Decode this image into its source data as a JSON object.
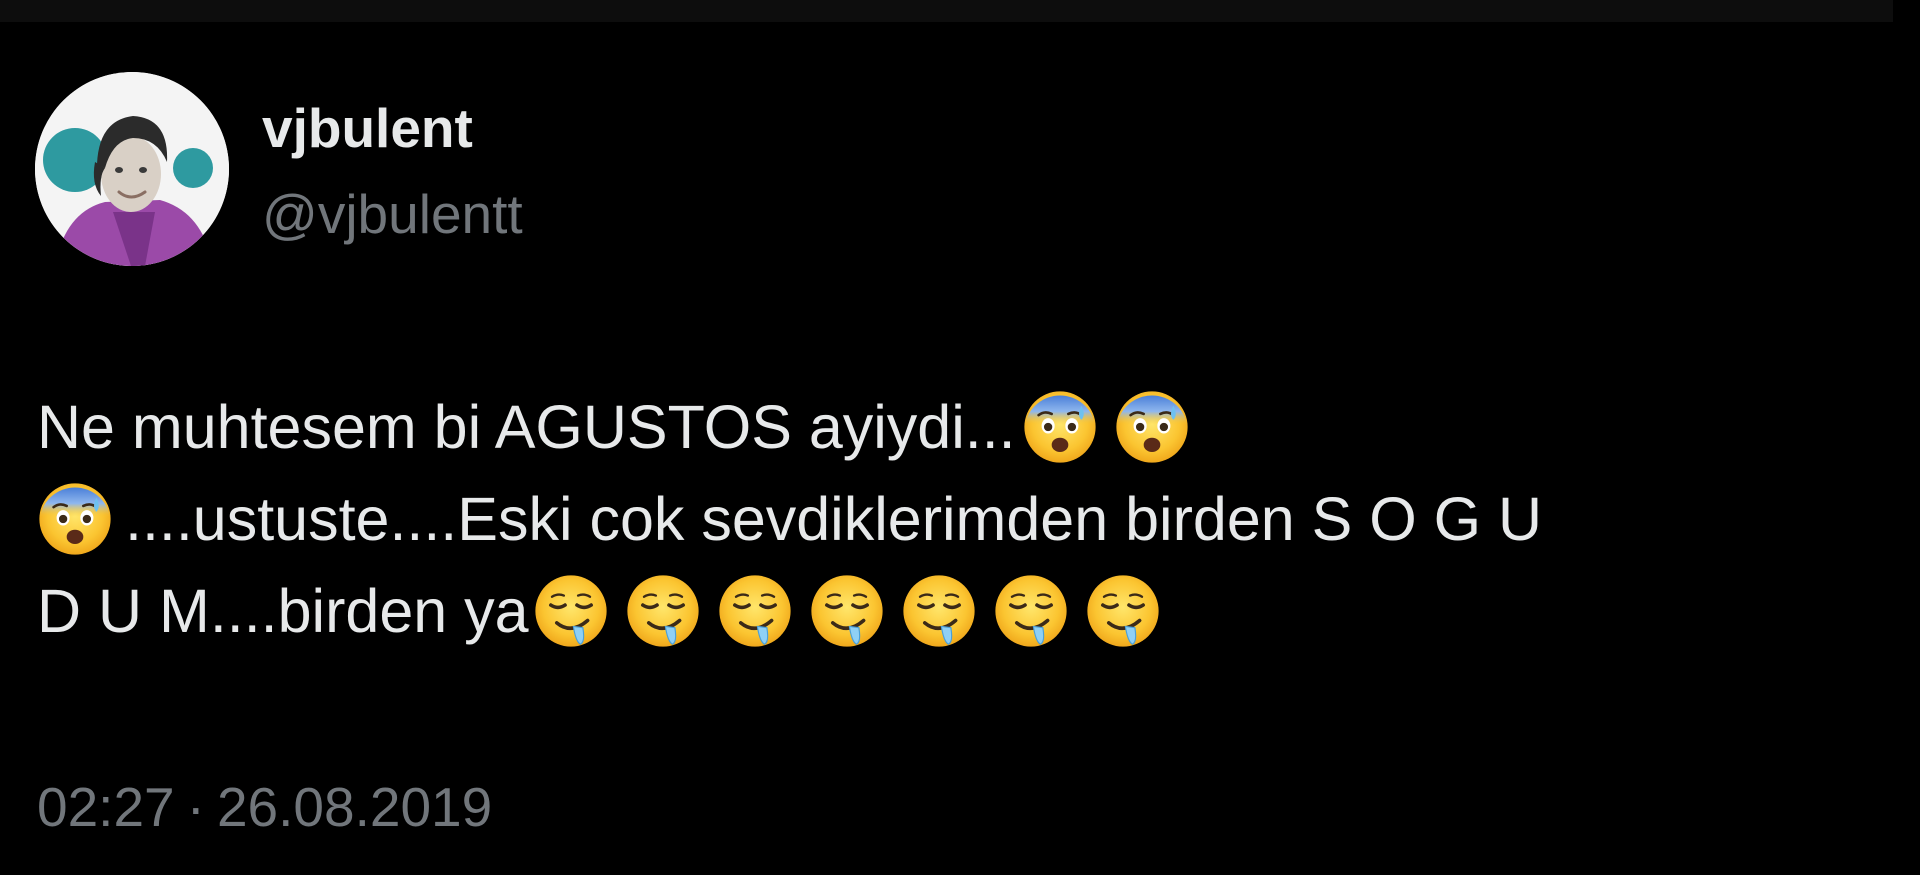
{
  "author": {
    "display_name": "vjbulent",
    "handle": "@vjbulentt",
    "avatar_icon": "profile-photo-avatar"
  },
  "tweet": {
    "line1_text": "Ne muhtesem bi AGUSTOS ayiydi...",
    "line2_text": "....ustuste....Eski cok sevdiklerimden birden S O G U",
    "line3_text": "D U M....birden ya",
    "line1_emojis": [
      "anxious-face-with-sweat-icon",
      "anxious-face-with-sweat-icon"
    ],
    "line2_emojis": [
      "anxious-face-with-sweat-icon"
    ],
    "line3_emojis": [
      "drooling-face-icon",
      "drooling-face-icon",
      "drooling-face-icon",
      "drooling-face-icon",
      "drooling-face-icon",
      "drooling-face-icon",
      "drooling-face-icon"
    ]
  },
  "meta": {
    "time": "02:27",
    "separator": "·",
    "date": "26.08.2019"
  },
  "colors": {
    "background": "#000000",
    "primary_text": "#e7e9ea",
    "secondary_text": "#71767b"
  }
}
